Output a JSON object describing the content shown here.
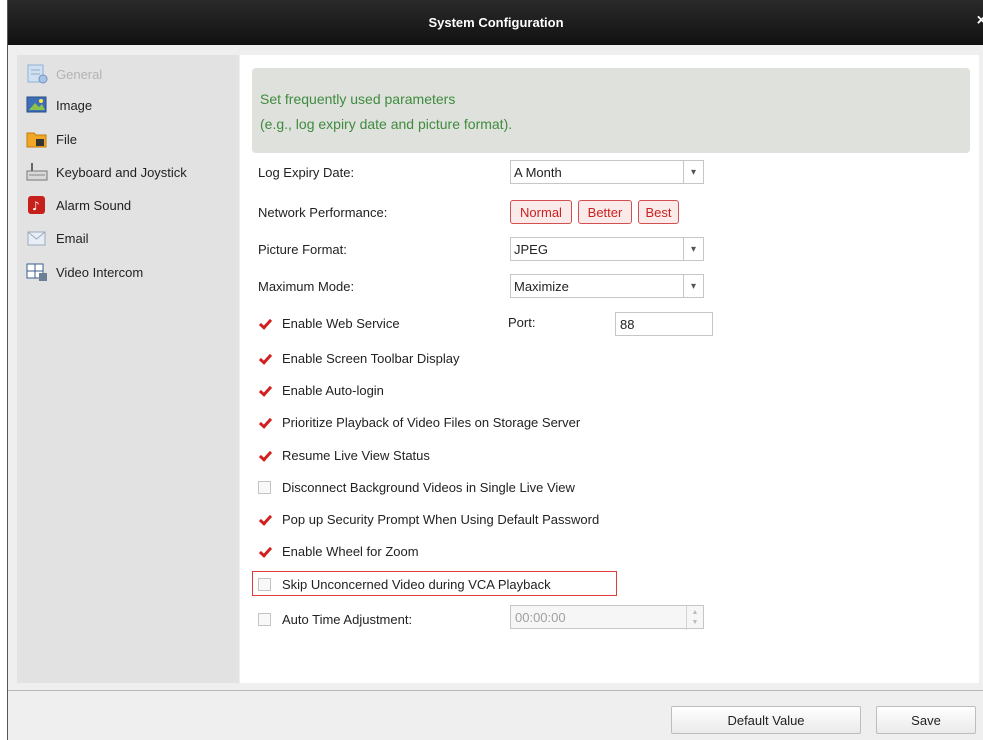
{
  "window": {
    "title": "System Configuration",
    "close_glyph": "×"
  },
  "sidebar": {
    "items": [
      {
        "label": "General",
        "icon": "general-settings-icon"
      },
      {
        "label": "Image",
        "icon": "image-icon"
      },
      {
        "label": "File",
        "icon": "folder-icon"
      },
      {
        "label": "Keyboard and Joystick",
        "icon": "keyboard-icon"
      },
      {
        "label": "Alarm Sound",
        "icon": "alarm-sound-icon"
      },
      {
        "label": "Email",
        "icon": "email-icon"
      },
      {
        "label": "Video Intercom",
        "icon": "video-intercom-icon"
      }
    ]
  },
  "hint": {
    "line1": "Set frequently used parameters",
    "line2": "(e.g., log expiry date and picture format)."
  },
  "form": {
    "log_expiry": {
      "label": "Log Expiry Date:",
      "value": "A Month"
    },
    "network_perf": {
      "label": "Network Performance:",
      "options": [
        "Normal",
        "Better",
        "Best"
      ]
    },
    "picture_format": {
      "label": "Picture Format:",
      "value": "JPEG"
    },
    "maximum_mode": {
      "label": "Maximum Mode:",
      "value": "Maximize"
    },
    "port": {
      "label": "Port:",
      "value": "88"
    },
    "checkboxes": [
      {
        "label": "Enable Web Service",
        "checked": true
      },
      {
        "label": "Enable Screen Toolbar Display",
        "checked": true
      },
      {
        "label": "Enable Auto-login",
        "checked": true
      },
      {
        "label": "Prioritize Playback of Video Files on Storage Server",
        "checked": true
      },
      {
        "label": "Resume Live View Status",
        "checked": true
      },
      {
        "label": "Disconnect Background Videos in Single Live View",
        "checked": false
      },
      {
        "label": "Pop up Security Prompt When Using Default Password",
        "checked": true
      },
      {
        "label": "Enable Wheel for Zoom",
        "checked": true
      },
      {
        "label": "Skip Unconcerned Video during VCA Playback",
        "checked": false
      },
      {
        "label": "Auto Time Adjustment:",
        "checked": false
      }
    ],
    "auto_time": {
      "value": "00:00:00"
    }
  },
  "footer": {
    "default_label": "Default Value",
    "save_label": "Save"
  },
  "colors": {
    "accent_red": "#d22020",
    "hint_green": "#3f8b3f",
    "titlebar": "#1a1a1a"
  }
}
